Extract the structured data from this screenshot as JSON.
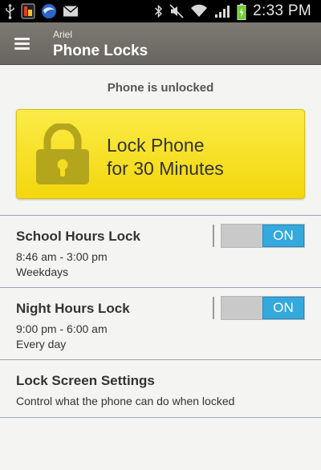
{
  "status_bar": {
    "time": "2:33 PM",
    "left_icons": [
      "usb-icon",
      "app-notification-icon",
      "browser-icon",
      "email-icon"
    ],
    "right_icons": [
      "bluetooth-icon",
      "mute-icon",
      "wifi-icon",
      "signal-icon",
      "battery-charging-icon"
    ]
  },
  "header": {
    "subtitle": "Ariel",
    "title": "Phone Locks",
    "menu_icon": "hamburger-menu-icon",
    "bg_color": "#747169"
  },
  "main": {
    "lock_status": "Phone is unlocked",
    "lock_button": {
      "line1": "Lock Phone",
      "line2": "for 30 Minutes",
      "icon": "padlock-icon",
      "color": "#f7e02a"
    },
    "settings": [
      {
        "title": "School Hours Lock",
        "line1": "8:46 am - 3:00 pm",
        "line2": "Weekdays",
        "toggle": "ON"
      },
      {
        "title": "Night Hours Lock",
        "line1": "9:00 pm - 6:00 am",
        "line2": "Every day",
        "toggle": "ON"
      },
      {
        "title": "Lock Screen Settings",
        "line1": "Control what the phone can do when locked"
      }
    ],
    "accent_color": "#33a9dd"
  }
}
